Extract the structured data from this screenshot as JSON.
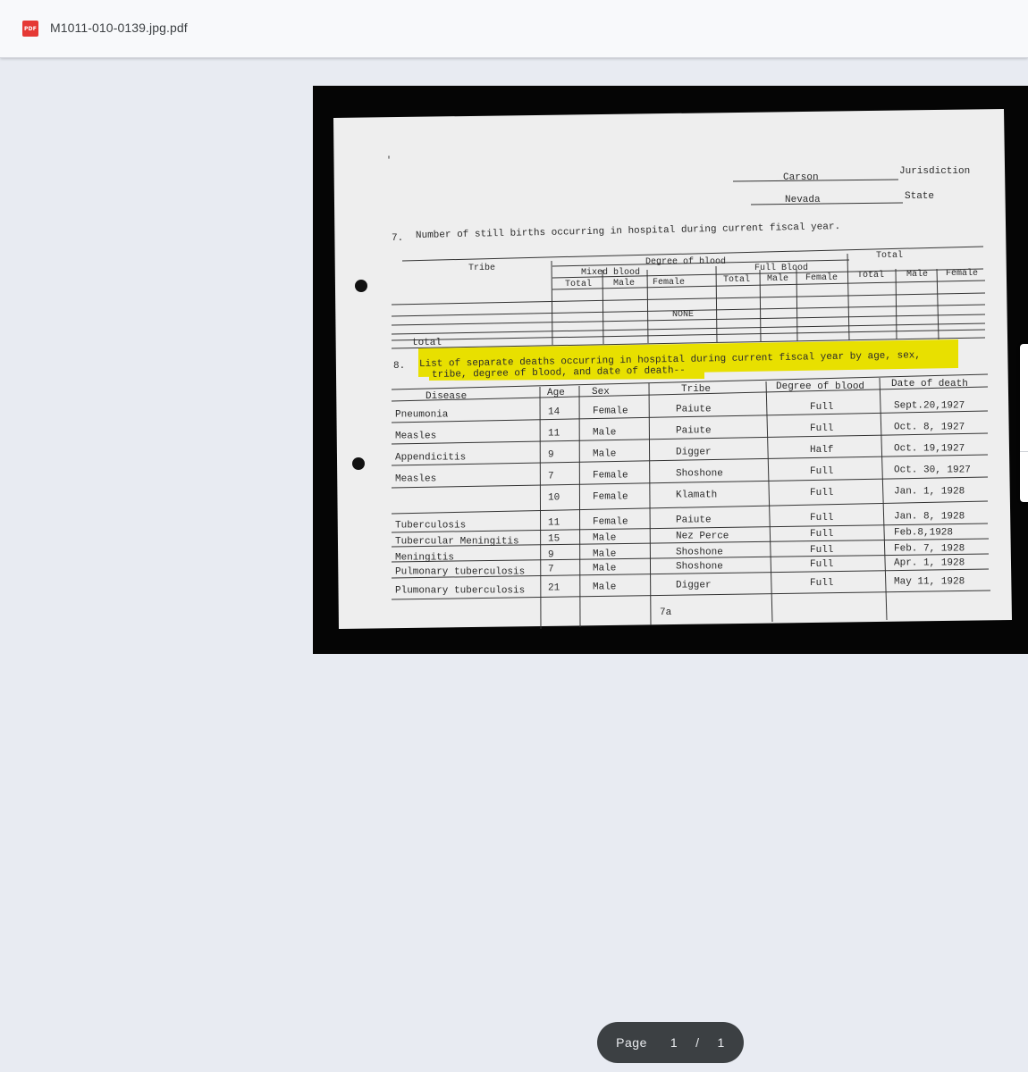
{
  "app": {
    "file_name": "M1011-010-0139.jpg.pdf",
    "file_icon_label": "PDF",
    "file_icon": "pdf-file-icon",
    "accent_color": "#e53935"
  },
  "document": {
    "jurisdiction_value": "Carson",
    "jurisdiction_label": "Jurisdiction",
    "state_value": "Nevada",
    "state_label": "State",
    "section7": {
      "number": "7.",
      "text": "Number of still births occurring in hospital during current fiscal year.",
      "col_tribe": "Tribe",
      "col_degree": "Degree of blood",
      "col_mixed": "Mixed blood",
      "col_full": "Full Blood",
      "col_total_group": "Total",
      "sub_total": "Total",
      "sub_male": "Male",
      "sub_female": "Female",
      "none_label": "NONE",
      "total_row": "total"
    },
    "section8": {
      "number": "8.",
      "text_line1": "List of separate deaths occurring in hospital during current fiscal year by age, sex,",
      "text_line2": "tribe, degree of blood, and date of death--",
      "highlight_color": "#e8e000",
      "headers": [
        "Disease",
        "Age",
        "Sex",
        "Tribe",
        "Degree of blood",
        "Date of death"
      ],
      "rows": [
        {
          "disease": "Pneumonia",
          "age": "14",
          "sex": "Female",
          "tribe": "Paiute",
          "blood": "Full",
          "date": "Sept.20,1927"
        },
        {
          "disease": "Measles",
          "age": "11",
          "sex": "Male",
          "tribe": "Paiute",
          "blood": "Full",
          "date": "Oct. 8, 1927"
        },
        {
          "disease": "Appendicitis",
          "age": "9",
          "sex": "Male",
          "tribe": "Digger",
          "blood": "Half",
          "date": "Oct. 19,1927"
        },
        {
          "disease": "Measles",
          "age": "7",
          "sex": "Female",
          "tribe": "Shoshone",
          "blood": "Full",
          "date": "Oct. 30, 1927"
        },
        {
          "disease": "",
          "age": "10",
          "sex": "Female",
          "tribe": "Klamath",
          "blood": "Full",
          "date": "Jan. 1, 1928"
        },
        {
          "disease": "Tuberculosis",
          "age": "11",
          "sex": "Female",
          "tribe": "Paiute",
          "blood": "Full",
          "date": "Jan. 8, 1928"
        },
        {
          "disease": "Tubercular Meningitis",
          "age": "15",
          "sex": "Male",
          "tribe": "Nez Perce",
          "blood": "Full",
          "date": "Feb.8,1928"
        },
        {
          "disease": "Meningitis",
          "age": "9",
          "sex": "Male",
          "tribe": "Shoshone",
          "blood": "Full",
          "date": "Feb. 7, 1928"
        },
        {
          "disease": "Pulmonary tuberculosis",
          "age": "7",
          "sex": "Male",
          "tribe": "Shoshone",
          "blood": "Full",
          "date": "Apr. 1, 1928"
        },
        {
          "disease": "Plumonary tuberculosis",
          "age": "21",
          "sex": "Male",
          "tribe": "Digger",
          "blood": "Full",
          "date": "May 11, 1928"
        }
      ],
      "page_number": "7a"
    }
  },
  "pager": {
    "label": "Page",
    "current": "1",
    "separator": "/",
    "total": "1"
  }
}
